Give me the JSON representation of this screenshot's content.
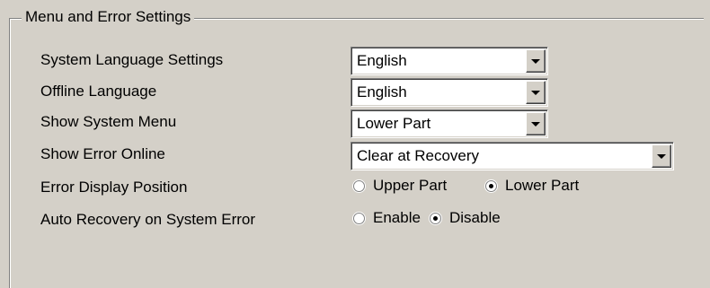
{
  "group": {
    "title": "Menu and Error Settings"
  },
  "rows": {
    "system_language": {
      "label": "System Language Settings",
      "value": "English"
    },
    "offline_language": {
      "label": "Offline Language",
      "value": "English"
    },
    "show_system_menu": {
      "label": "Show System Menu",
      "value": "Lower Part"
    },
    "show_error_online": {
      "label": "Show Error Online",
      "value": "Clear at Recovery"
    },
    "error_display_position": {
      "label": "Error Display Position",
      "options": [
        "Upper Part",
        "Lower Part"
      ],
      "selected": "Lower Part"
    },
    "auto_recovery": {
      "label": "Auto Recovery on System Error",
      "options": [
        "Enable",
        "Disable"
      ],
      "selected": "Disable"
    }
  }
}
